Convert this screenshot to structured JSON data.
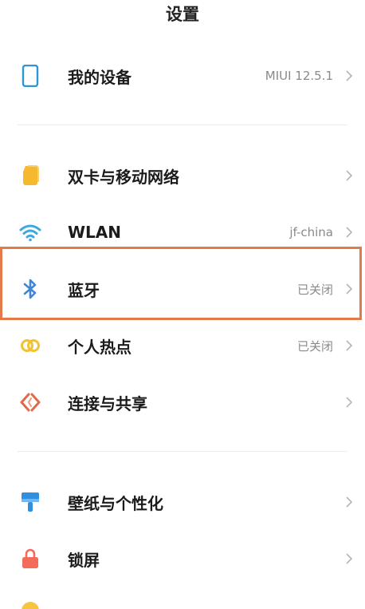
{
  "header": {
    "title": "设置"
  },
  "rows": [
    {
      "label": "我的设备",
      "value": "MIUI 12.5.1",
      "icon": "phone-icon",
      "color": "#2f96d6"
    },
    {
      "label": "双卡与移动网络",
      "value": "",
      "icon": "sim-card-icon",
      "color": "#f5b82e"
    },
    {
      "label": "WLAN",
      "value": "jf-china",
      "icon": "wifi-icon",
      "color": "#3fa7e0"
    },
    {
      "label": "蓝牙",
      "value": "已关闭",
      "icon": "bluetooth-icon",
      "color": "#3f86d8"
    },
    {
      "label": "个人热点",
      "value": "已关闭",
      "icon": "hotspot-icon",
      "color": "#f1c232"
    },
    {
      "label": "连接与共享",
      "value": "",
      "icon": "connection-share-icon",
      "color": "#e06a4a"
    },
    {
      "label": "壁纸与个性化",
      "value": "",
      "icon": "wallpaper-icon",
      "color": "#2f8fe0"
    },
    {
      "label": "锁屏",
      "value": "",
      "icon": "lock-icon",
      "color": "#f26b5b"
    }
  ],
  "colors": {
    "highlight": "#e47a4a"
  }
}
